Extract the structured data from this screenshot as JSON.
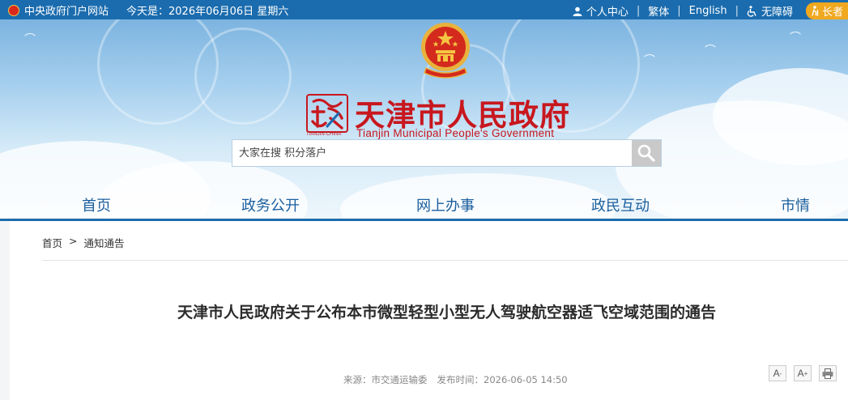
{
  "topbar": {
    "portal_link": "中央政府门户网站",
    "date": "今天是：2026年06月06日 星期六",
    "user_center": "个人中心",
    "sep": "|",
    "traditional": "繁体",
    "english": "English",
    "accessibility": "无障碍",
    "elder_mode": "长者"
  },
  "header": {
    "site_title": "天津市人民政府",
    "site_subtitle": "Tianjin Municipal People's Government",
    "seal_text": "天津",
    "seal_caption": "TIANJIN·CHINA"
  },
  "search": {
    "placeholder": "大家在搜 积分落户"
  },
  "nav": {
    "items": [
      "首页",
      "政务公开",
      "网上办事",
      "政民互动",
      "市情"
    ]
  },
  "breadcrumb": {
    "home": "首页",
    "sep": ">",
    "current": "通知通告"
  },
  "article": {
    "title": "天津市人民政府关于公布本市微型轻型小型无人驾驶航空器适飞空域范围的通告",
    "source": "来源：市交通运输委",
    "publish_time": "发布时间：2026-06-05 14:50"
  },
  "tools": {
    "font_smaller": "A",
    "font_larger": "A",
    "smaller_mark": "-",
    "larger_mark": "+"
  },
  "colors": {
    "topbar": "#1b6cae",
    "title_red": "#c8171e",
    "nav_blue": "#1b5f9e",
    "elder_orange": "#f0a81f"
  }
}
